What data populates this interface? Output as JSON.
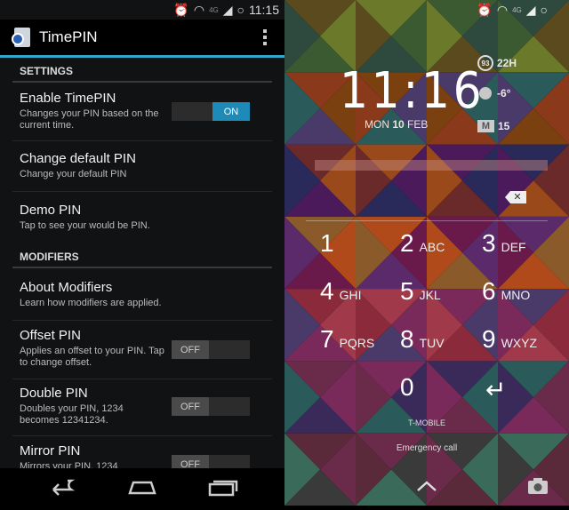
{
  "left": {
    "status": {
      "time": "11:15",
      "network": "4G",
      "icons": [
        "alarm-icon",
        "wifi-icon",
        "signal-icon",
        "battery-icon"
      ]
    },
    "app_title": "TimePIN",
    "sections": [
      {
        "header": "SETTINGS",
        "items": [
          {
            "title": "Enable TimePIN",
            "summary": "Changes your PIN based on the current time.",
            "toggle": "ON"
          },
          {
            "title": "Change default PIN",
            "summary": "Change your default PIN"
          },
          {
            "title": "Demo PIN",
            "summary": "Tap to see your would be PIN."
          }
        ]
      },
      {
        "header": "MODIFIERS",
        "items": [
          {
            "title": "About Modifiers",
            "summary": "Learn how modifiers are applied."
          },
          {
            "title": "Offset PIN",
            "summary": "Applies an offset to your PIN. Tap to change offset.",
            "toggle": "OFF"
          },
          {
            "title": "Double PIN",
            "summary": "Doubles your PIN, 1234 becomes 12341234.",
            "toggle": "OFF"
          },
          {
            "title": "Mirror PIN",
            "summary": "Mirrors your PIN, 1234",
            "toggle": "OFF"
          }
        ]
      }
    ]
  },
  "right": {
    "status": {
      "network": "4G"
    },
    "clock": "11:16",
    "date": {
      "day": "MON",
      "num": "10",
      "month": "FEB"
    },
    "widgets": {
      "battery": "93",
      "battery_time": "22H",
      "weather": "-6°",
      "mail": "15"
    },
    "keys": [
      {
        "n": "1",
        "l": ""
      },
      {
        "n": "2",
        "l": "ABC"
      },
      {
        "n": "3",
        "l": "DEF"
      },
      {
        "n": "4",
        "l": "GHI"
      },
      {
        "n": "5",
        "l": "JKL"
      },
      {
        "n": "6",
        "l": "MNO"
      },
      {
        "n": "7",
        "l": "PQRS"
      },
      {
        "n": "8",
        "l": "TUV"
      },
      {
        "n": "9",
        "l": "WXYZ"
      },
      {
        "n": "0",
        "l": ""
      }
    ],
    "carrier": "T-MOBILE",
    "emergency": "Emergency call"
  }
}
